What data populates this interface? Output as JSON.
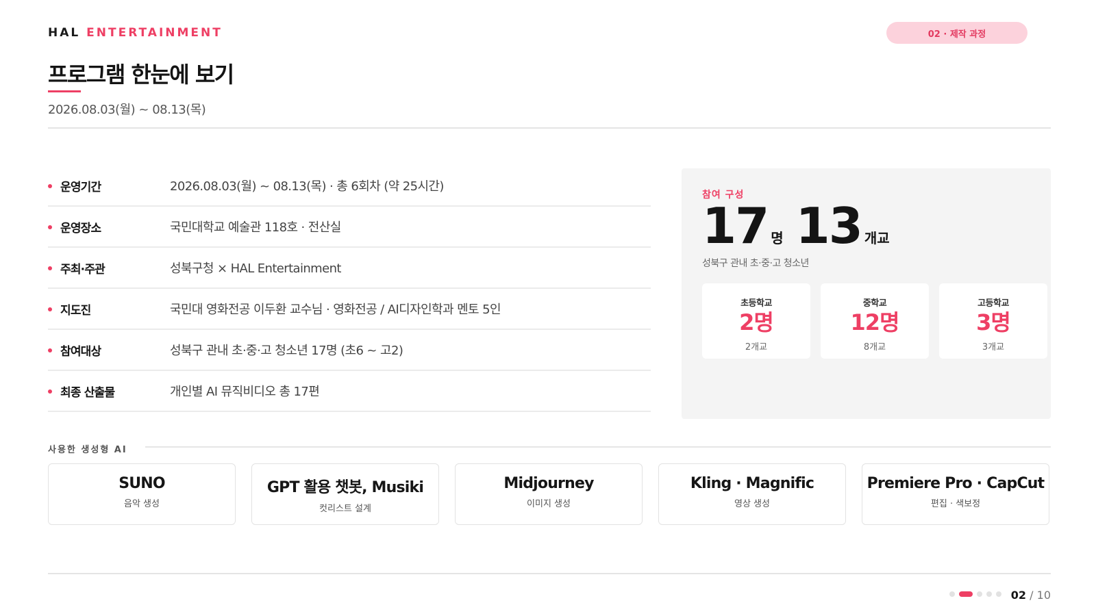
{
  "header": {
    "brand_part1": "HAL",
    "brand_part2": "ENTERTAINMENT",
    "section_pill": "02 · 제작 과정",
    "title": "프로그램 한눈에 보기",
    "subtitle": "2026.08.03(월) ~ 08.13(목)"
  },
  "info_rows": [
    {
      "label": "운영기간",
      "value": "2026.08.03(월) ~ 08.13(목) · 총 6회차 (약 25시간)"
    },
    {
      "label": "운영장소",
      "value": "국민대학교 예술관 118호 · 전산실"
    },
    {
      "label": "주최·주관",
      "value": "성북구청 × HAL Entertainment"
    },
    {
      "label": "지도진",
      "value": "국민대 영화전공 이두환 교수님 · 영화전공 / AI디자인학과 멘토 5인"
    },
    {
      "label": "참여대상",
      "value": "성북구 관내 초·중·고 청소년 17명 (초6 ~ 고2)"
    },
    {
      "label": "최종 산출물",
      "value": "개인별 AI 뮤직비디오 총 17편"
    }
  ],
  "participation": {
    "eyebrow": "참여 구성",
    "students_number": "17",
    "students_unit": "명",
    "schools_number": "13",
    "schools_unit": "개교",
    "description": "성북구 관내 초·중·고 청소년",
    "breakdown": [
      {
        "label": "초등학교",
        "value": "2명",
        "sub": "2개교"
      },
      {
        "label": "중학교",
        "value": "12명",
        "sub": "8개교"
      },
      {
        "label": "고등학교",
        "value": "3명",
        "sub": "3개교"
      }
    ]
  },
  "ai_tools": {
    "heading": "사용한 생성형 AI",
    "items": [
      {
        "name": "SUNO",
        "desc": "음악 생성"
      },
      {
        "name": "GPT 활용 챗봇, Musiki",
        "desc": "컷리스트 설계"
      },
      {
        "name": "Midjourney",
        "desc": "이미지 생성"
      },
      {
        "name": "Kling · Magnific",
        "desc": "영상 생성"
      },
      {
        "name": "Premiere Pro · CapCut",
        "desc": "편집 · 색보정"
      }
    ]
  },
  "footer": {
    "current_page": "02",
    "total_pages": "/ 10",
    "dots_total": 5,
    "active_dot": 2
  },
  "colors": {
    "accent": "#ee3f64",
    "pill_bg": "#fcd2dc",
    "panel_bg": "#f4f4f4"
  }
}
